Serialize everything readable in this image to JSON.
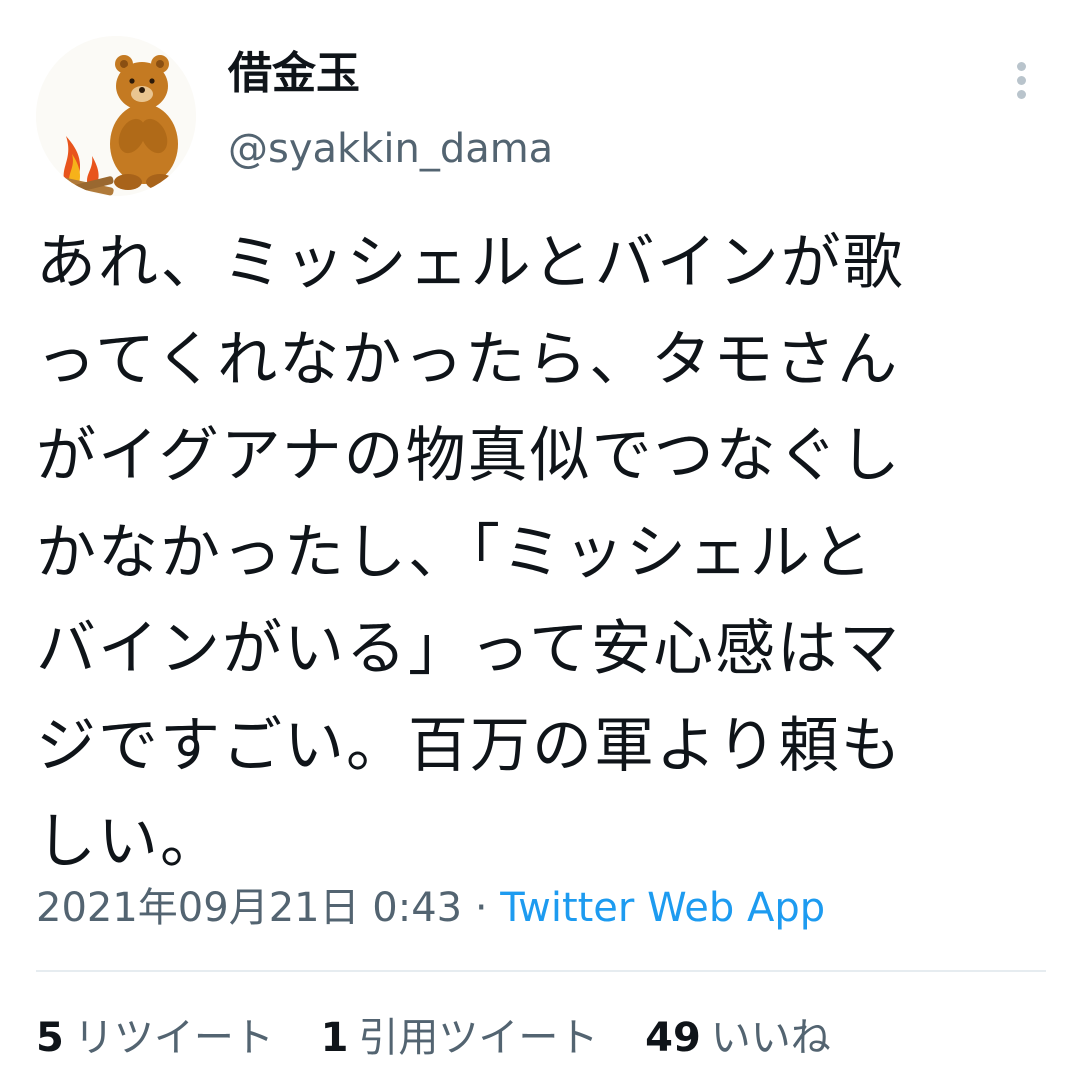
{
  "author": {
    "display_name": "借金玉",
    "handle": "@syakkin_dama",
    "avatar_icon": "bear-campfire-avatar-icon"
  },
  "menu": {
    "icon": "more-vertical-icon"
  },
  "tweet": {
    "lines": [
      "あれ、ミッシェルとバインが歌",
      "ってくれなかったら、タモさん",
      "がイグアナの物真似でつなぐし",
      "かなかったし、「ミッシェルと",
      "バインがいる」って安心感はマ",
      "ジですごい。百万の軍より頼も",
      "しい。"
    ]
  },
  "meta": {
    "timestamp": "2021年09月21日 0:43",
    "separator": "·",
    "source": "Twitter Web App"
  },
  "stats": {
    "retweets_count": "5",
    "retweets_label": "リツイート",
    "quotes_count": "1",
    "quotes_label": "引用ツイート",
    "likes_count": "49",
    "likes_label": "いいね"
  },
  "colors": {
    "text": "#0f1419",
    "secondary": "#536471",
    "link": "#1d9bf0",
    "divider": "#e6ecf0"
  }
}
